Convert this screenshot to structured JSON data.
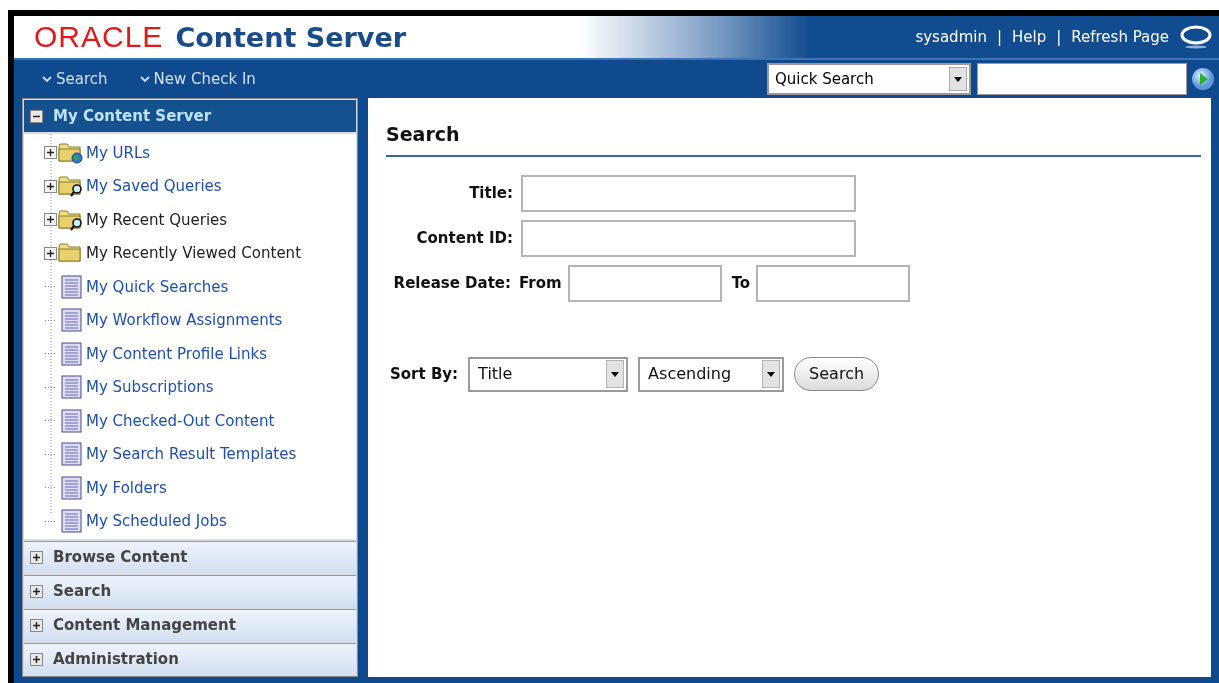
{
  "header": {
    "brand": "ORACLE",
    "product": "Content Server",
    "links": [
      "sysadmin",
      "Help",
      "Refresh Page"
    ],
    "separator": "|"
  },
  "nav": {
    "menus": [
      "Search",
      "New Check In"
    ],
    "quick_search": {
      "value": "Quick Search"
    }
  },
  "sidebar": {
    "sections": [
      {
        "title": "My Content Server",
        "expanded": true,
        "items": [
          {
            "label": "My URLs",
            "kind": "folder-globe",
            "link": true
          },
          {
            "label": "My Saved Queries",
            "kind": "folder-search",
            "link": true
          },
          {
            "label": "My Recent Queries",
            "kind": "folder-search",
            "link": false
          },
          {
            "label": "My Recently Viewed Content",
            "kind": "folder",
            "link": false
          },
          {
            "label": "My Quick Searches",
            "kind": "document",
            "link": true
          },
          {
            "label": "My Workflow Assignments",
            "kind": "document",
            "link": true
          },
          {
            "label": "My Content Profile Links",
            "kind": "document",
            "link": true
          },
          {
            "label": "My Subscriptions",
            "kind": "document",
            "link": true
          },
          {
            "label": "My Checked-Out Content",
            "kind": "document",
            "link": true
          },
          {
            "label": "My Search Result Templates",
            "kind": "document",
            "link": true
          },
          {
            "label": "My Folders",
            "kind": "document",
            "link": true
          },
          {
            "label": "My Scheduled Jobs",
            "kind": "document",
            "link": true
          }
        ]
      },
      {
        "title": "Browse Content",
        "expanded": false
      },
      {
        "title": "Search",
        "expanded": false
      },
      {
        "title": "Content Management",
        "expanded": false
      },
      {
        "title": "Administration",
        "expanded": false
      }
    ]
  },
  "main": {
    "title": "Search",
    "fields": [
      {
        "label": "Title:"
      },
      {
        "label": "Content ID:"
      }
    ],
    "release_date": {
      "label": "Release Date:",
      "from": "From",
      "to": "To"
    },
    "sort": {
      "label": "Sort By:",
      "field": "Title",
      "order": "Ascending",
      "button": "Search"
    }
  }
}
